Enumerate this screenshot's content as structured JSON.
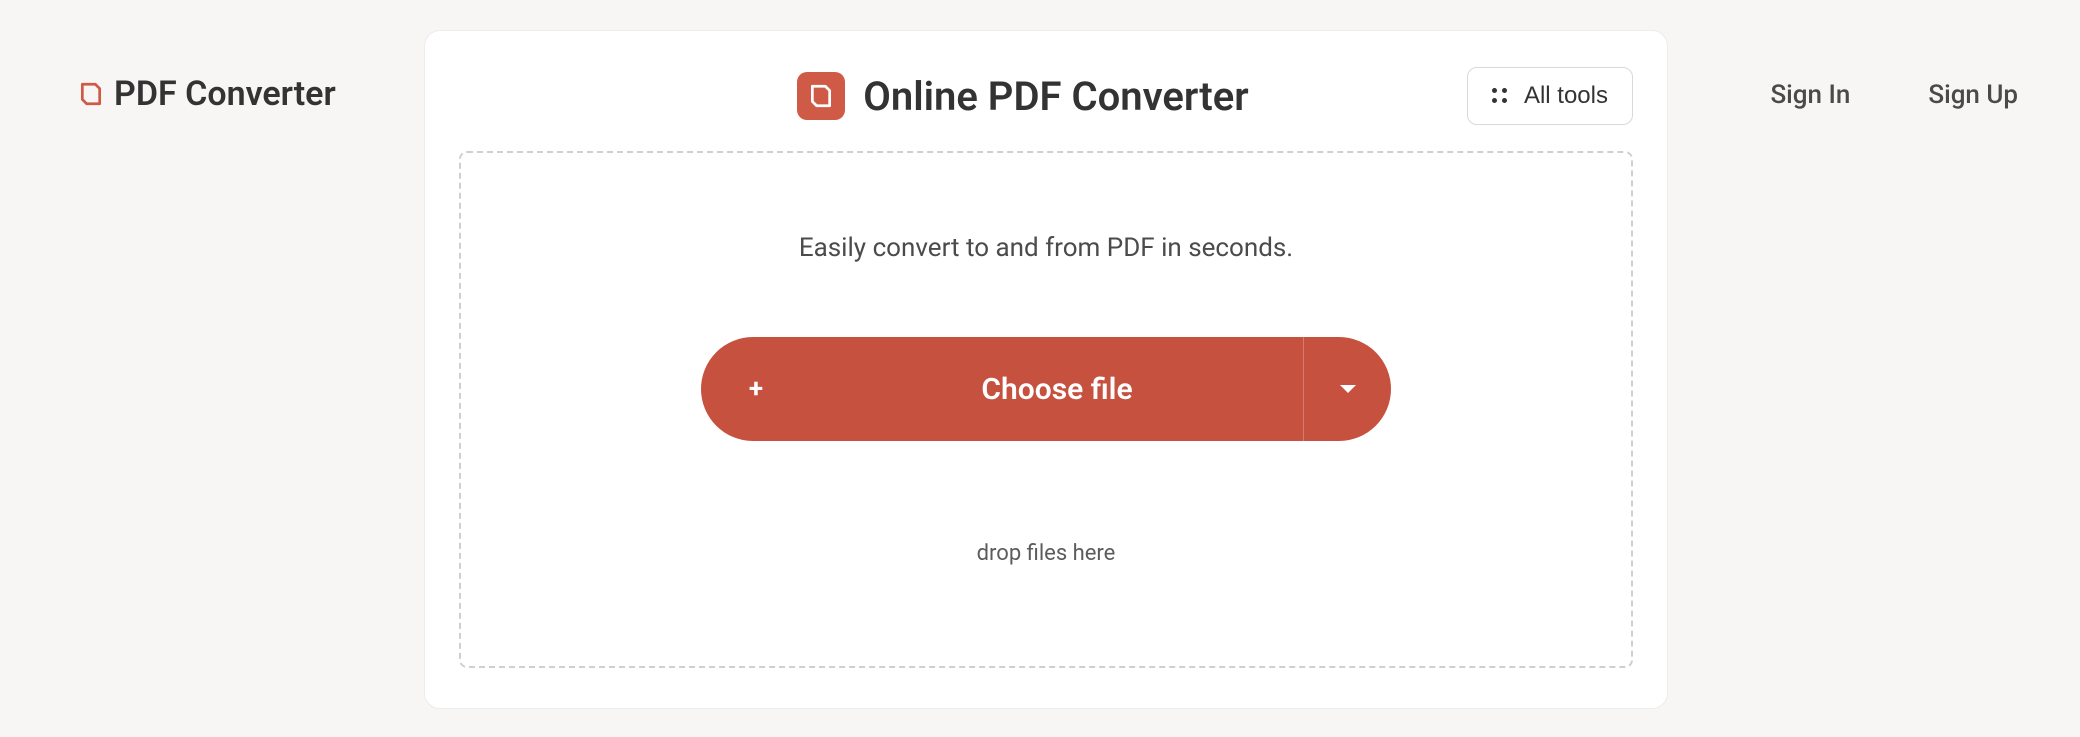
{
  "header": {
    "brand": "PDF Converter",
    "sign_in": "Sign In",
    "sign_up": "Sign Up"
  },
  "card": {
    "title": "Online PDF Converter",
    "all_tools_label": "All tools"
  },
  "dropzone": {
    "description": "Easily convert to and from PDF in seconds.",
    "choose_file_label": "Choose file",
    "plus_label": "+",
    "drop_hint": "drop files here"
  },
  "colors": {
    "accent": "#c6513f",
    "page_bg": "#f8f5f5"
  }
}
